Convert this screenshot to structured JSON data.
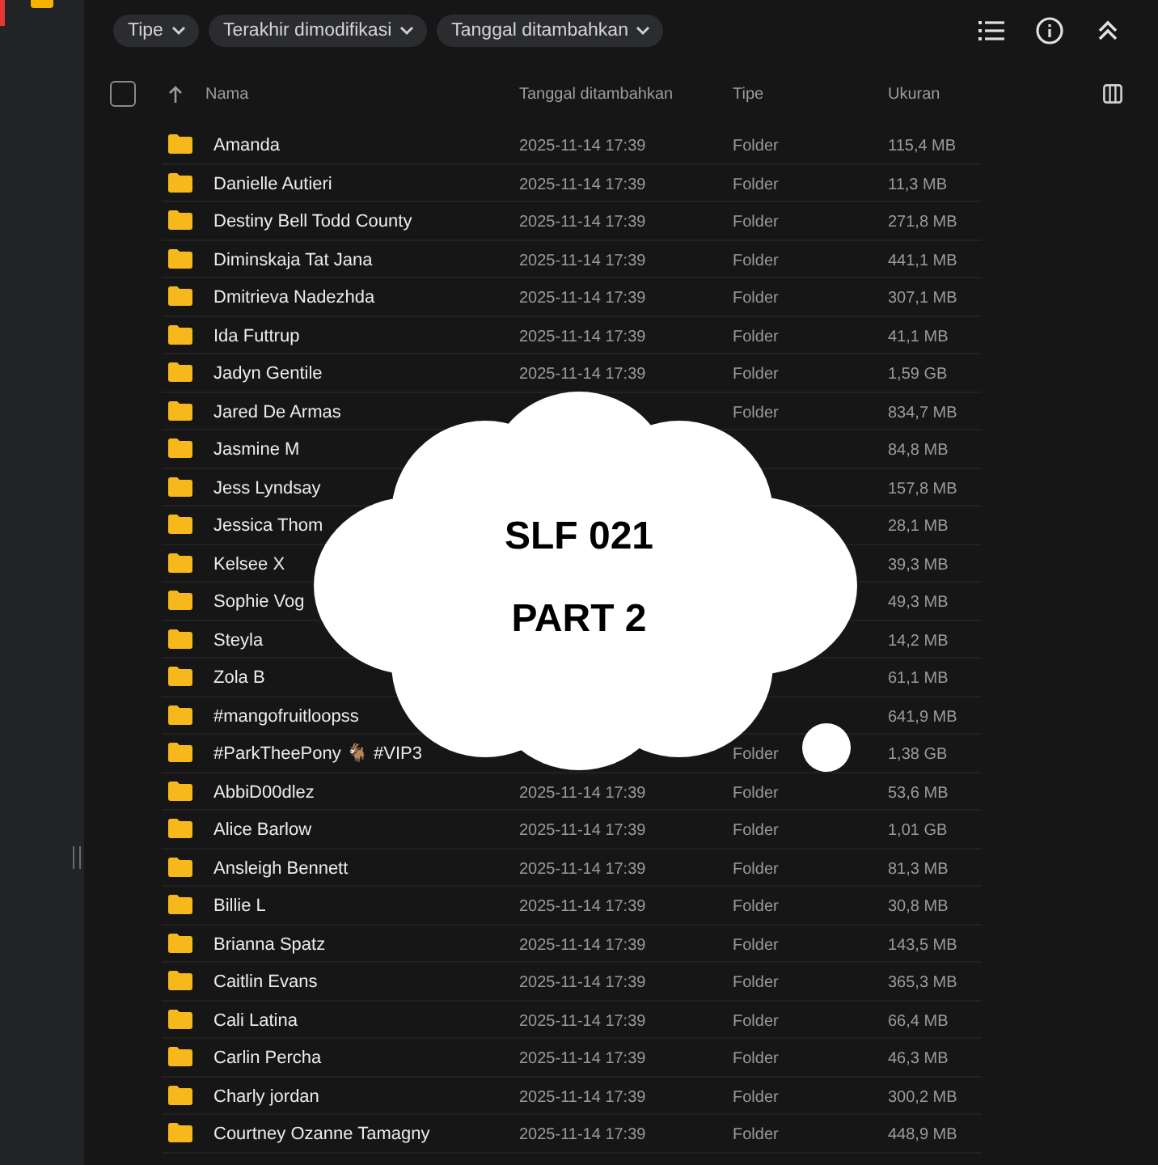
{
  "filters": [
    {
      "label": "Tipe"
    },
    {
      "label": "Terakhir dimodifikasi"
    },
    {
      "label": "Tanggal ditambahkan"
    }
  ],
  "header": {
    "select_all_checked": false,
    "columns": [
      {
        "label": "Nama",
        "sorted": true
      },
      {
        "label": "Tanggal ditambahkan",
        "sorted": false
      },
      {
        "label": "Tipe",
        "sorted": false
      },
      {
        "label": "Ukuran",
        "sorted": false
      }
    ]
  },
  "rows": [
    {
      "name": "Amanda",
      "date": "2025-11-14 17:39",
      "type": "Folder",
      "size": "115,4 MB"
    },
    {
      "name": "Danielle Autieri",
      "date": "2025-11-14 17:39",
      "type": "Folder",
      "size": "11,3 MB"
    },
    {
      "name": "Destiny Bell Todd County",
      "date": "2025-11-14 17:39",
      "type": "Folder",
      "size": "271,8 MB"
    },
    {
      "name": "Diminskaja Tat Jana",
      "date": "2025-11-14 17:39",
      "type": "Folder",
      "size": "441,1 MB"
    },
    {
      "name": "Dmitrieva Nadezhda",
      "date": "2025-11-14 17:39",
      "type": "Folder",
      "size": "307,1 MB"
    },
    {
      "name": "Ida Futtrup",
      "date": "2025-11-14 17:39",
      "type": "Folder",
      "size": "41,1 MB"
    },
    {
      "name": "Jadyn Gentile",
      "date": "2025-11-14 17:39",
      "type": "Folder",
      "size": "1,59 GB"
    },
    {
      "name": "Jared De Armas",
      "type": "Folder",
      "size": "834,7 MB"
    },
    {
      "name": "Jasmine M",
      "size": "84,8 MB"
    },
    {
      "name": "Jess Lyndsay",
      "size": "157,8 MB"
    },
    {
      "name": "Jessica Thom",
      "size": "28,1 MB"
    },
    {
      "name": "Kelsee X",
      "size": "39,3 MB"
    },
    {
      "name": "Sophie Vog",
      "size": "49,3 MB"
    },
    {
      "name": "Steyla",
      "size": "14,2 MB"
    },
    {
      "name": "Zola B",
      "size": "61,1 MB"
    },
    {
      "name": "#mangofruitloopss",
      "size": "641,9 MB"
    },
    {
      "name": "#ParkTheePony 🐐 #VIP3",
      "type": "Folder",
      "size": "1,38 GB"
    },
    {
      "name": "AbbiD00dlez",
      "date": "2025-11-14 17:39",
      "type": "Folder",
      "size": "53,6 MB"
    },
    {
      "name": "Alice Barlow",
      "date": "2025-11-14 17:39",
      "type": "Folder",
      "size": "1,01 GB"
    },
    {
      "name": "Ansleigh Bennett",
      "date": "2025-11-14 17:39",
      "type": "Folder",
      "size": "81,3 MB"
    },
    {
      "name": "Billie L",
      "date": "2025-11-14 17:39",
      "type": "Folder",
      "size": "30,8 MB"
    },
    {
      "name": "Brianna Spatz",
      "date": "2025-11-14 17:39",
      "type": "Folder",
      "size": "143,5 MB"
    },
    {
      "name": "Caitlin Evans",
      "date": "2025-11-14 17:39",
      "type": "Folder",
      "size": "365,3 MB"
    },
    {
      "name": "Cali Latina",
      "date": "2025-11-14 17:39",
      "type": "Folder",
      "size": "66,4 MB"
    },
    {
      "name": "Carlin Percha",
      "date": "2025-11-14 17:39",
      "type": "Folder",
      "size": "46,3 MB"
    },
    {
      "name": "Charly jordan",
      "date": "2025-11-14 17:39",
      "type": "Folder",
      "size": "300,2 MB"
    },
    {
      "name": "Courtney Ozanne Tamagny",
      "date": "2025-11-14 17:39",
      "type": "Folder",
      "size": "448,9 MB"
    }
  ],
  "overlay": {
    "lines": [
      "SLF 021",
      "PART 2"
    ]
  }
}
